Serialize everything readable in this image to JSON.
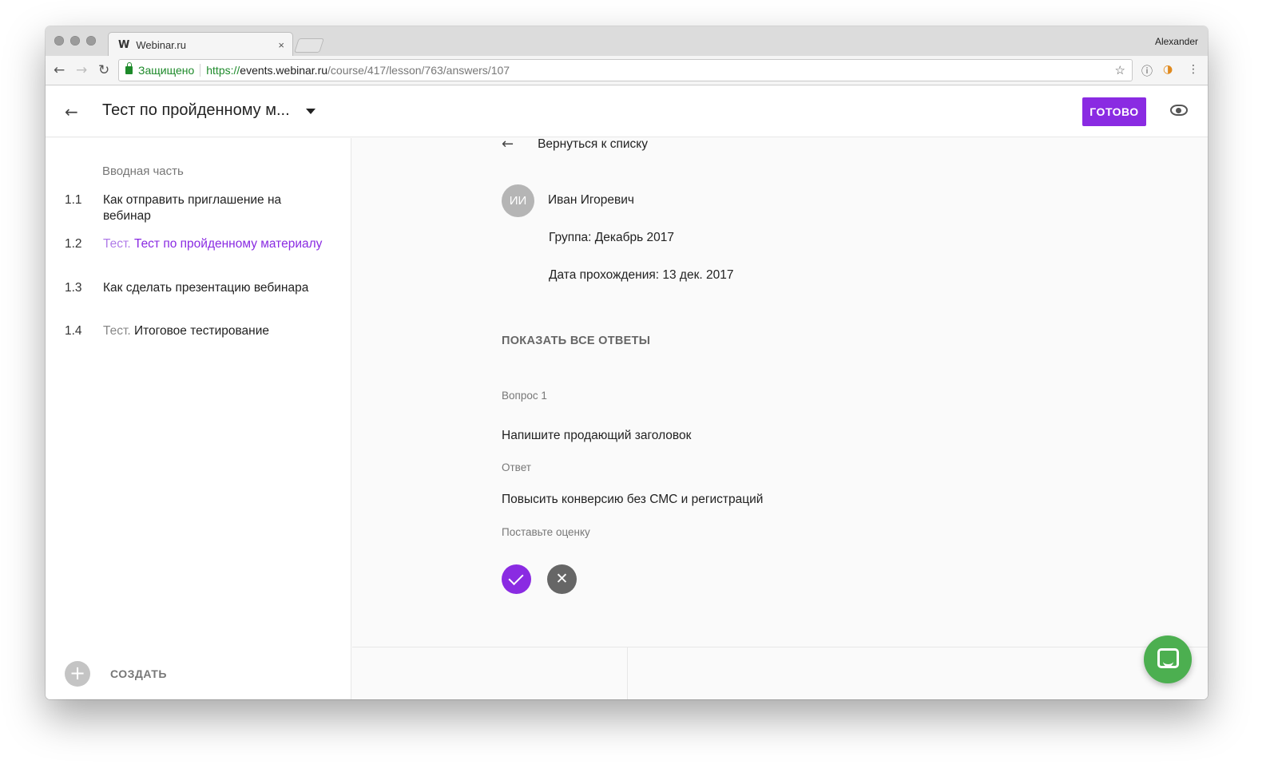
{
  "browser": {
    "tab_title": "Webinar.ru",
    "tab_favicon": "W",
    "tab_close": "×",
    "profile_name": "Alexander",
    "secure_label": "Защищено",
    "url_scheme": "https://",
    "url_host": "events.webinar.ru",
    "url_path": "/course/417/lesson/763/answers/107",
    "icons": {
      "back": "←",
      "forward": "→",
      "reload": "↻",
      "star": "☆",
      "info": "ⓘ",
      "menu": "⋮",
      "ext": "◑"
    }
  },
  "header": {
    "back_icon": "←",
    "title": "Тест по пройденному м...",
    "done_label": "ГОТОВО"
  },
  "sidebar": {
    "section_title": "Вводная часть",
    "lessons": [
      {
        "num": "1.1",
        "prefix": "",
        "title": "Как отправить приглашение на вебинар"
      },
      {
        "num": "1.2",
        "prefix": "Тест.",
        "title": "Тест по пройденному материалу"
      },
      {
        "num": "1.3",
        "prefix": "",
        "title": "Как сделать презентацию вебинара"
      },
      {
        "num": "1.4",
        "prefix": "Тест.",
        "title": "Итоговое тестирование"
      }
    ],
    "create_icon": "+",
    "create_label": "СОЗДАТЬ"
  },
  "main": {
    "back_icon": "←",
    "back_label": "Вернуться к списку",
    "avatar_initials": "ИИ",
    "student_name": "Иван Игоревич",
    "group": "Группа: Декабрь 2017",
    "date": "Дата прохождения: 13 дек. 2017",
    "show_all": "ПОКАЗАТЬ ВСЕ ОТВЕТЫ",
    "question_label": "Вопрос 1",
    "question_text": "Напишите продающий заголовок",
    "answer_label": "Ответ",
    "answer_text": "Повысить конверсию без СМС и регистраций",
    "grade_label": "Поставьте оценку",
    "reject_icon": "✕"
  },
  "colors": {
    "accent": "#8a2be2",
    "chat": "#4caf50",
    "secure": "#1d8a2a"
  }
}
